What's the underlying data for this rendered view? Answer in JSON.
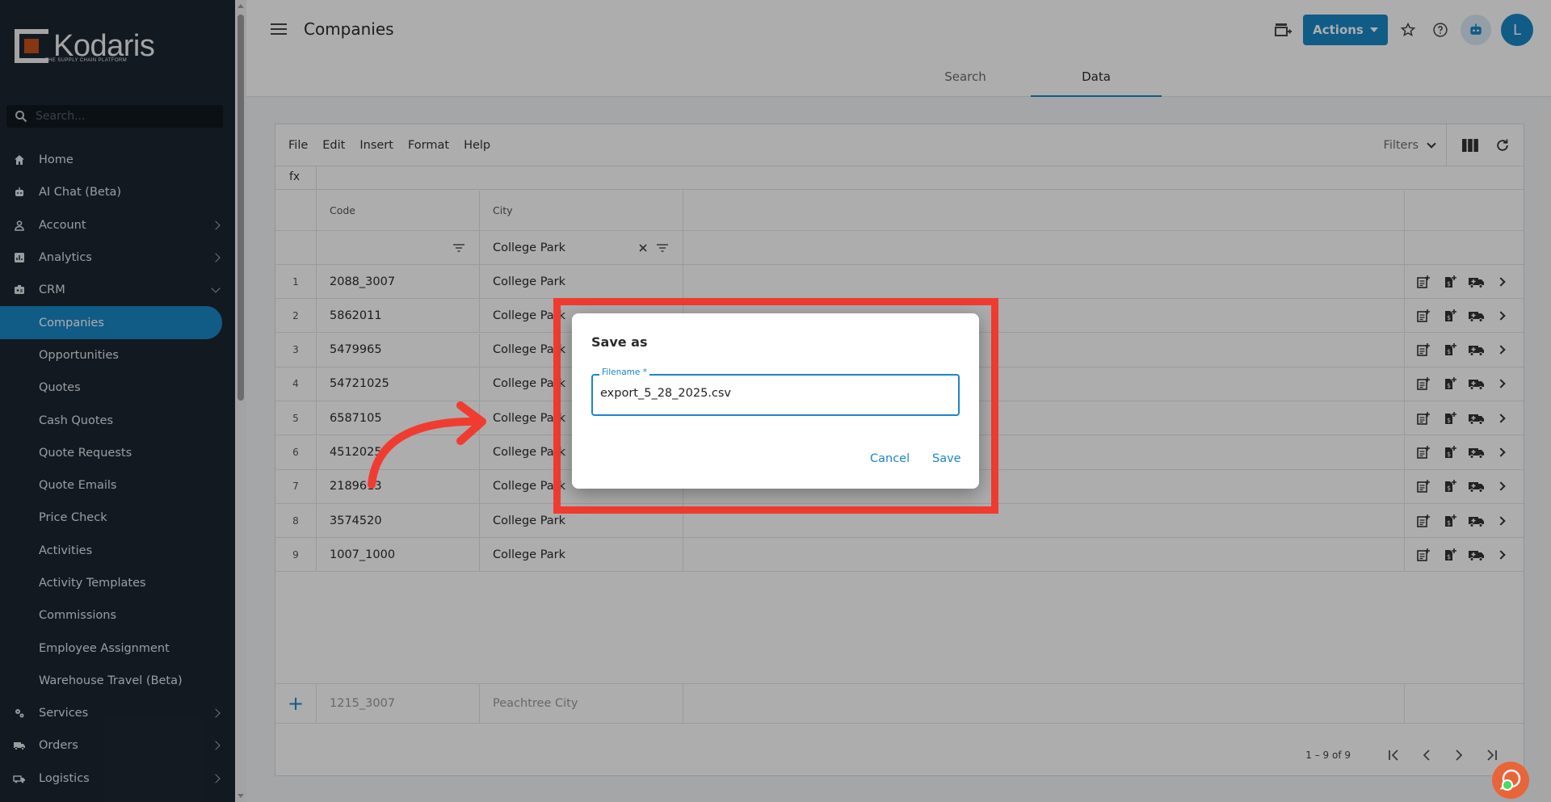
{
  "brand": {
    "name": "Kodaris",
    "tagline": "THE SUPPLY CHAIN PLATFORM"
  },
  "search": {
    "placeholder": "Search..."
  },
  "nav": {
    "items": [
      {
        "label": "Home",
        "icon": "home-icon"
      },
      {
        "label": "AI Chat (Beta)",
        "icon": "robot-icon"
      },
      {
        "label": "Account",
        "icon": "person-icon",
        "chevron": "right"
      },
      {
        "label": "Analytics",
        "icon": "chart-icon",
        "chevron": "right"
      },
      {
        "label": "CRM",
        "icon": "id-card-icon",
        "chevron": "down"
      },
      {
        "label": "Companies",
        "sub": true,
        "active": true
      },
      {
        "label": "Opportunities",
        "sub": true
      },
      {
        "label": "Quotes",
        "sub": true
      },
      {
        "label": "Cash Quotes",
        "sub": true
      },
      {
        "label": "Quote Requests",
        "sub": true
      },
      {
        "label": "Quote Emails",
        "sub": true
      },
      {
        "label": "Price Check",
        "sub": true
      },
      {
        "label": "Activities",
        "sub": true
      },
      {
        "label": "Activity Templates",
        "sub": true
      },
      {
        "label": "Commissions",
        "sub": true
      },
      {
        "label": "Employee Assignment",
        "sub": true
      },
      {
        "label": "Warehouse Travel (Beta)",
        "sub": true
      },
      {
        "label": "Services",
        "icon": "gears-icon",
        "chevron": "right"
      },
      {
        "label": "Orders",
        "icon": "truck-icon",
        "chevron": "right"
      },
      {
        "label": "Logistics",
        "icon": "shipping-icon",
        "chevron": "right"
      }
    ]
  },
  "header": {
    "title": "Companies",
    "actions_label": "Actions",
    "avatar_initial": "L",
    "tabs": [
      {
        "label": "Search"
      },
      {
        "label": "Data",
        "active": true
      }
    ]
  },
  "grid": {
    "menu": [
      "File",
      "Edit",
      "Insert",
      "Format",
      "Help"
    ],
    "filters_label": "Filters",
    "fx_label": "fx",
    "columns": {
      "code": "Code",
      "city": "City"
    },
    "city_filter_value": "College Park",
    "rows": [
      {
        "num": "1",
        "code": "2088_3007",
        "city": "College Park"
      },
      {
        "num": "2",
        "code": "5862011",
        "city": "College Park"
      },
      {
        "num": "3",
        "code": "5479965",
        "city": "College Park"
      },
      {
        "num": "4",
        "code": "54721025",
        "city": "College Park"
      },
      {
        "num": "5",
        "code": "6587105",
        "city": "College Park"
      },
      {
        "num": "6",
        "code": "4512025",
        "city": "College Park"
      },
      {
        "num": "7",
        "code": "2189613",
        "city": "College Park"
      },
      {
        "num": "8",
        "code": "3574520",
        "city": "College Park"
      },
      {
        "num": "9",
        "code": "1007_1000",
        "city": "College Park"
      }
    ],
    "new_row": {
      "code_placeholder": "1215_3007",
      "city_placeholder": "Peachtree City"
    },
    "pagination": "1 – 9 of 9"
  },
  "dialog": {
    "title": "Save as",
    "field_label": "Filename *",
    "filename": "export_5_28_2025.csv",
    "cancel_label": "Cancel",
    "save_label": "Save"
  },
  "colors": {
    "accent": "#1a86c8",
    "sidebar": "#1c2632",
    "highlight": "#f03c30",
    "brand_orange": "#c8501e"
  }
}
